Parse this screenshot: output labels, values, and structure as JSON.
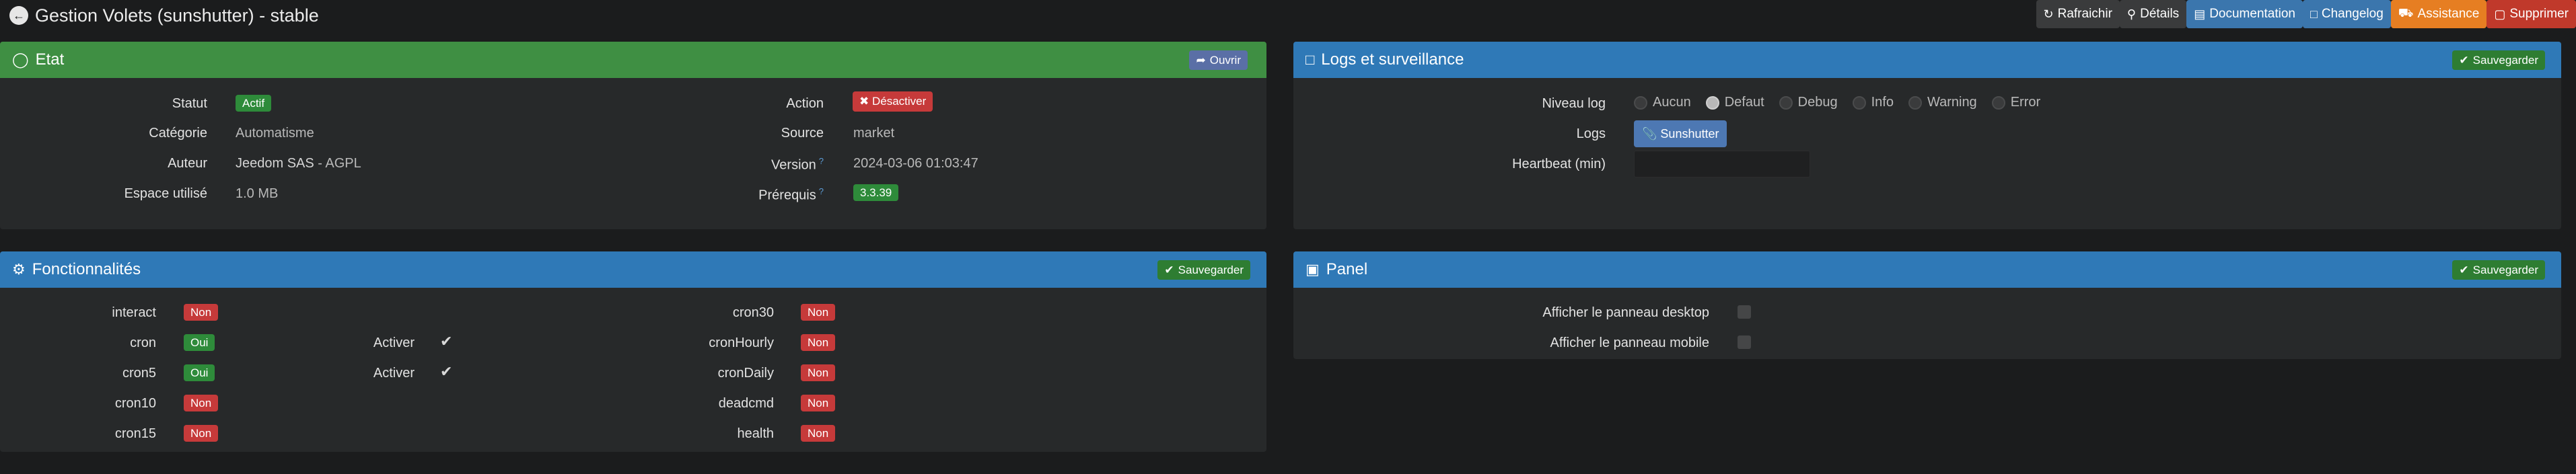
{
  "header": {
    "title": "Gestion Volets (sunshutter) - stable",
    "buttons": [
      {
        "label": "Rafraichir",
        "icon": "refresh-icon",
        "color": "#3a3b3c"
      },
      {
        "label": "Détails",
        "icon": "search-icon",
        "color": "#3a3b3c"
      },
      {
        "label": "Documentation",
        "icon": "book-icon",
        "color": "#3b76ad"
      },
      {
        "label": "Changelog",
        "icon": "file-icon",
        "color": "#3b76ad"
      },
      {
        "label": "Assistance",
        "icon": "ambulance-icon",
        "color": "#e67e22"
      },
      {
        "label": "Supprimer",
        "icon": "trash-icon",
        "color": "#c0392b"
      }
    ]
  },
  "etat": {
    "title": "Etat",
    "open_label": "Ouvrir",
    "left": [
      {
        "label": "Statut",
        "value": "Actif"
      },
      {
        "label": "Catégorie",
        "value": "Automatisme"
      },
      {
        "label": "Auteur",
        "value": "Jeedom SAS",
        "value2": " - AGPL"
      },
      {
        "label": "Espace utilisé",
        "value": "1.0 MB"
      }
    ],
    "right": [
      {
        "label": "Action",
        "value": "Désactiver"
      },
      {
        "label": "Source",
        "value": "market"
      },
      {
        "label": "Version",
        "value": "2024-03-06 01:03:47"
      },
      {
        "label": "Prérequis",
        "value": "3.3.39"
      }
    ],
    "help_mark": "?"
  },
  "logs": {
    "title": "Logs et surveillance",
    "save_label": "Sauvegarder",
    "niveau_label": "Niveau log",
    "levels": [
      "Aucun",
      "Defaut",
      "Debug",
      "Info",
      "Warning",
      "Error"
    ],
    "selected_level": "Defaut",
    "logs_label": "Logs",
    "logs_button": "Sunshutter",
    "heartbeat_label": "Heartbeat (min)",
    "heartbeat_value": ""
  },
  "fonctionnalites": {
    "title": "Fonctionnalités",
    "save_label": "Sauvegarder",
    "left": [
      {
        "name": "interact",
        "value": "Non"
      },
      {
        "name": "cron",
        "value": "Oui",
        "activer": "Activer"
      },
      {
        "name": "cron5",
        "value": "Oui",
        "activer": "Activer"
      },
      {
        "name": "cron10",
        "value": "Non"
      },
      {
        "name": "cron15",
        "value": "Non"
      }
    ],
    "right": [
      {
        "name": "cron30",
        "value": "Non"
      },
      {
        "name": "cronHourly",
        "value": "Non"
      },
      {
        "name": "cronDaily",
        "value": "Non"
      },
      {
        "name": "deadcmd",
        "value": "Non"
      },
      {
        "name": "health",
        "value": "Non"
      }
    ]
  },
  "panel": {
    "title": "Panel",
    "save_label": "Sauvegarder",
    "desktop_label": "Afficher le panneau desktop",
    "mobile_label": "Afficher le panneau mobile"
  }
}
